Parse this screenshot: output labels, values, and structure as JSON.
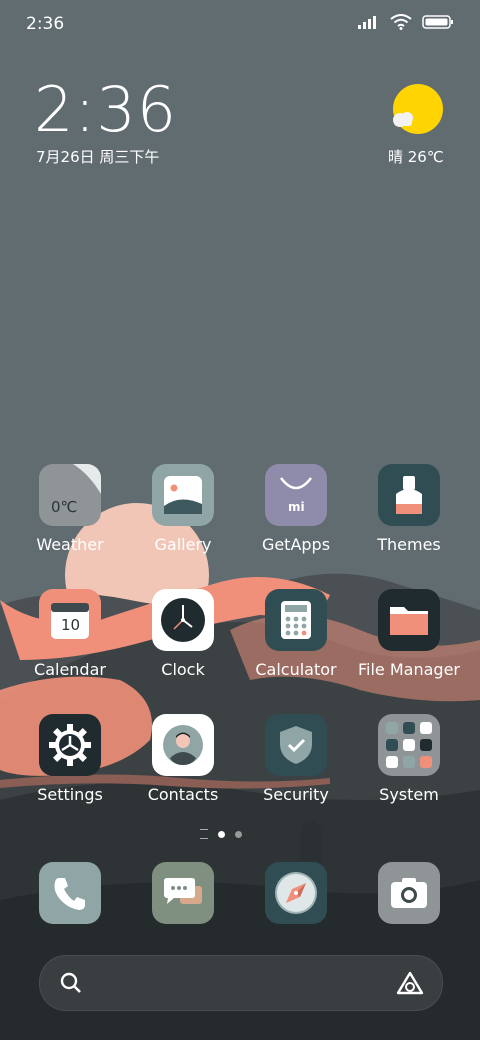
{
  "status_bar": {
    "time": "2:36"
  },
  "widget": {
    "time": "2:36",
    "date": "7月26日 周三下午",
    "weather": "晴 26℃"
  },
  "apps": [
    {
      "label": "Weather",
      "name": "weather",
      "sub": "0℃"
    },
    {
      "label": "Gallery",
      "name": "gallery"
    },
    {
      "label": "GetApps",
      "name": "getapps",
      "sub": "mi"
    },
    {
      "label": "Themes",
      "name": "themes"
    },
    {
      "label": "Calendar",
      "name": "calendar",
      "sub": "10"
    },
    {
      "label": "Clock",
      "name": "clock"
    },
    {
      "label": "Calculator",
      "name": "calculator"
    },
    {
      "label": "File Manager",
      "name": "file-manager"
    },
    {
      "label": "Settings",
      "name": "settings"
    },
    {
      "label": "Contacts",
      "name": "contacts"
    },
    {
      "label": "Security",
      "name": "security"
    },
    {
      "label": "System",
      "name": "system"
    }
  ],
  "page_indicator": {
    "pages": 2,
    "current": 1
  },
  "dock": [
    {
      "name": "phone"
    },
    {
      "name": "messages"
    },
    {
      "name": "browser"
    },
    {
      "name": "camera"
    }
  ],
  "colors": {
    "sky": "#606b70",
    "accent_salmon": "#f0907a",
    "dark_hill": "#2f3537"
  }
}
